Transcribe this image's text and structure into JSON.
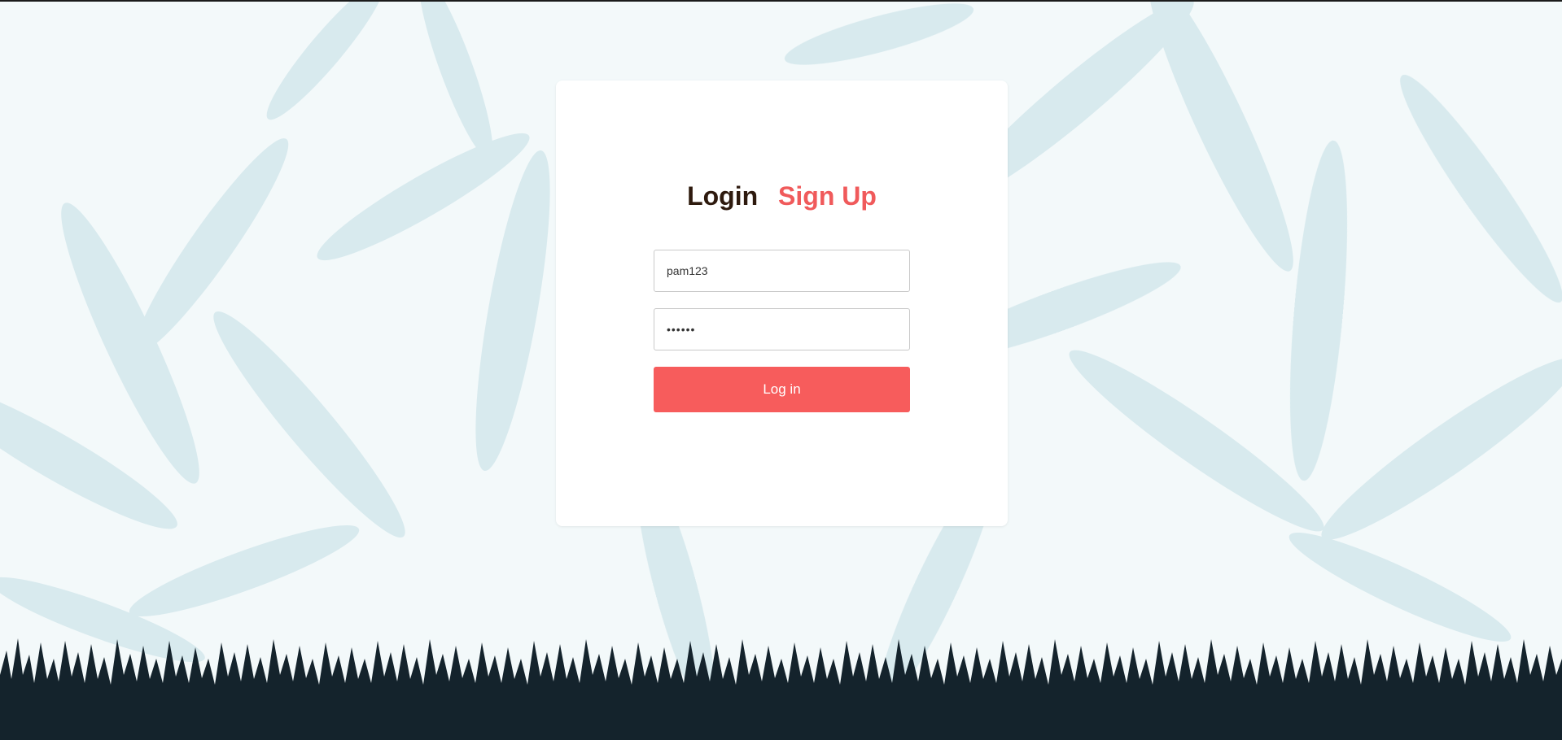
{
  "colors": {
    "accent": "#f75c5c",
    "active_tab": "#2e1a0e",
    "inactive_tab": "#f05a5b",
    "grass": "#14232c",
    "leaf": "#c8e2e8"
  },
  "auth": {
    "tabs": [
      {
        "label": "Login",
        "active": true
      },
      {
        "label": "Sign Up",
        "active": false
      }
    ],
    "username_value": "pam123",
    "password_value": "pam123",
    "submit_label": "Log in"
  }
}
